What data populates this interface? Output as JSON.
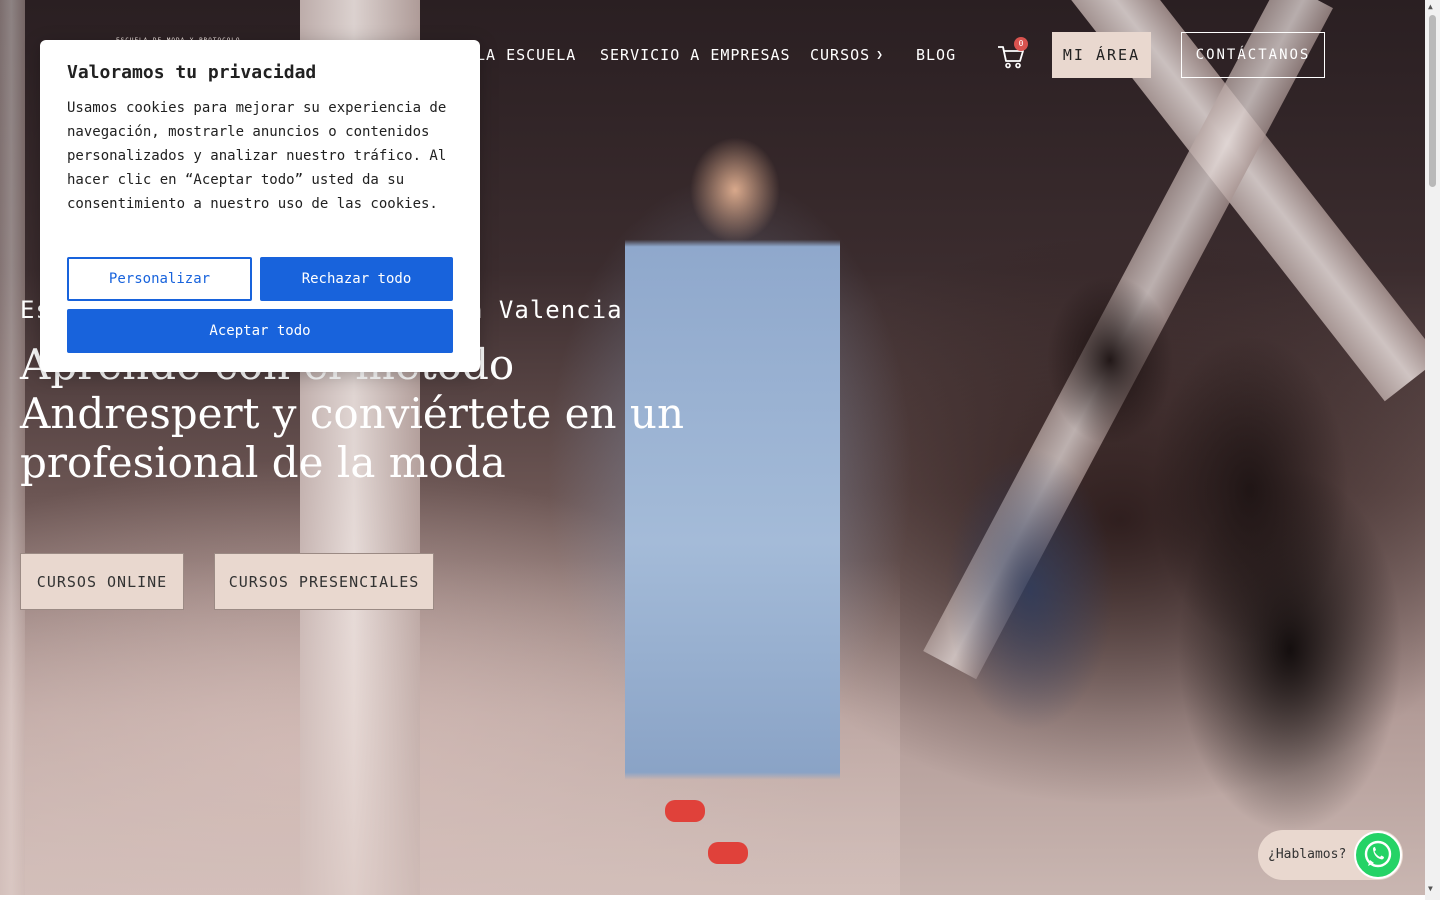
{
  "header": {
    "logo_text": "ESCUELA DE MODA Y PROTOCOLO",
    "nav": [
      {
        "label": "LA ESCUELA"
      },
      {
        "label": "SERVICIO A EMPRESAS"
      },
      {
        "label": "CURSOS",
        "has_dropdown": true
      },
      {
        "label": "BLOG"
      }
    ],
    "cart_count": "0",
    "my_area_label": "MI ÁREA",
    "contact_label": "CONTÁCTANOS"
  },
  "hero": {
    "eyebrow": "Escuela de moda y protocolo en Valencia",
    "headline": "Aprende con el método Andrespert y conviértete en un profesional de la moda",
    "buttons": [
      "CURSOS ONLINE",
      "CURSOS PRESENCIALES"
    ]
  },
  "cookie_banner": {
    "title": "Valoramos tu privacidad",
    "text": "Usamos cookies para mejorar su experiencia de navegación, mostrarle anuncios o contenidos personalizados y analizar nuestro tráfico. Al hacer clic en “Aceptar todo” usted da su consentimiento a nuestro uso de las cookies.",
    "customize_label": "Personalizar",
    "reject_label": "Rechazar todo",
    "accept_label": "Aceptar todo"
  },
  "whatsapp": {
    "label": "¿Hablamos?",
    "icon": "whatsapp-icon",
    "color": "#25d366"
  },
  "colors": {
    "accent": "#1863dc",
    "beige": "#e9d8cf"
  }
}
